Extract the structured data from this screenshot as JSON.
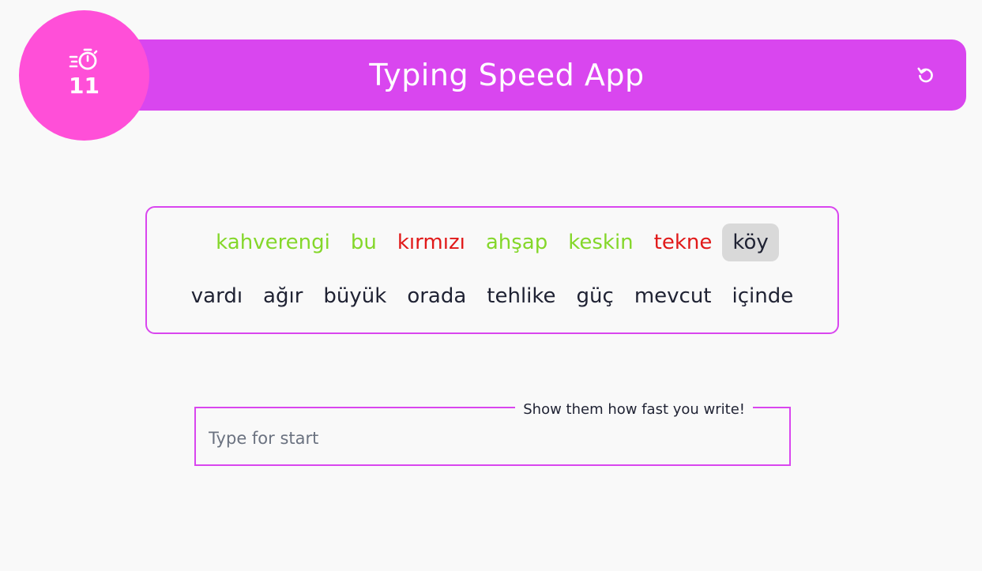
{
  "header": {
    "title": "Typing Speed App",
    "accent_color": "#d946ef",
    "reset_icon": "reset-icon"
  },
  "timer": {
    "value": "11",
    "icon": "stopwatch-icon",
    "color": "#ff4fd8"
  },
  "words": {
    "row1": [
      {
        "text": "kahverengi",
        "state": "correct"
      },
      {
        "text": "bu",
        "state": "correct"
      },
      {
        "text": "kırmızı",
        "state": "wrong"
      },
      {
        "text": "ahşap",
        "state": "correct"
      },
      {
        "text": "keskin",
        "state": "correct"
      },
      {
        "text": "tekne",
        "state": "wrong"
      },
      {
        "text": "köy",
        "state": "current"
      }
    ],
    "row2": [
      {
        "text": "vardı",
        "state": "pending"
      },
      {
        "text": "ağır",
        "state": "pending"
      },
      {
        "text": "büyük",
        "state": "pending"
      },
      {
        "text": "orada",
        "state": "pending"
      },
      {
        "text": "tehlike",
        "state": "pending"
      },
      {
        "text": "güç",
        "state": "pending"
      },
      {
        "text": "mevcut",
        "state": "pending"
      },
      {
        "text": "içinde",
        "state": "pending"
      }
    ],
    "colors": {
      "correct": "#84d72a",
      "wrong": "#e11919",
      "current_bg": "#d9d9d9"
    }
  },
  "input": {
    "legend": "Show them how fast you write!",
    "placeholder": "Type for start",
    "value": ""
  }
}
